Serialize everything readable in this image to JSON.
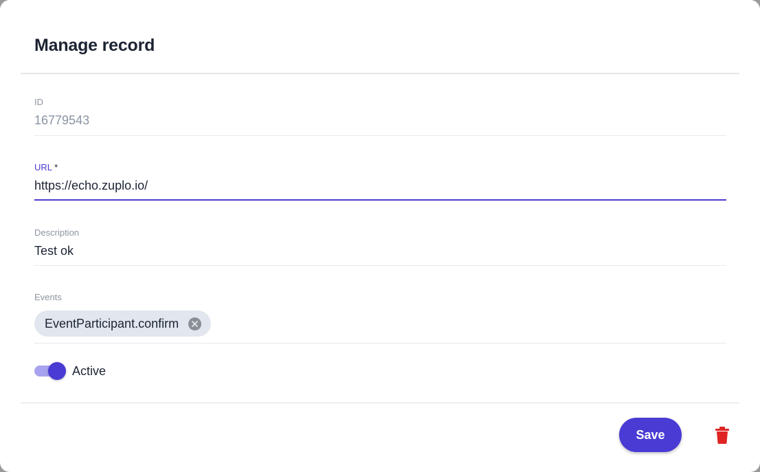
{
  "dialog": {
    "title": "Manage record"
  },
  "fields": {
    "id": {
      "label": "ID",
      "value": "16779543"
    },
    "url": {
      "label": "URL",
      "required_mark": "*",
      "value": "https://echo.zuplo.io/"
    },
    "description": {
      "label": "Description",
      "value": "Test ok"
    },
    "events": {
      "label": "Events",
      "chips": [
        {
          "label": "EventParticipant.confirm",
          "remove_icon": "close-circle-icon"
        }
      ]
    }
  },
  "active": {
    "label": "Active",
    "checked": true
  },
  "actions": {
    "save_label": "Save",
    "delete_icon": "trash-icon"
  },
  "colors": {
    "accent": "#4a3bd4",
    "accent_light": "#a8a3ee",
    "danger": "#e02424",
    "chip_bg": "#e2e6ee",
    "text": "#1c2333",
    "muted": "#8e95a1"
  }
}
